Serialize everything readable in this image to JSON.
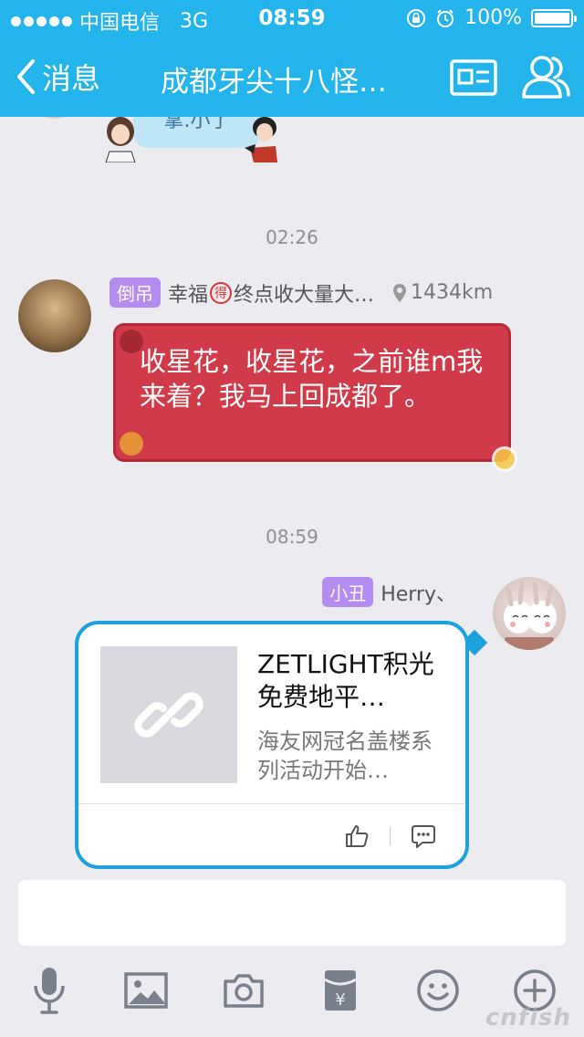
{
  "status_bar": {
    "carrier": "中国电信",
    "network": "3G",
    "time": "08:59",
    "battery": "100%",
    "battery_level": 1.0
  },
  "nav": {
    "back_label": "消息",
    "title": "成都牙尖十八怪…",
    "icons": {
      "back": "chevron-left-icon",
      "card": "group-card-icon",
      "profile": "group-members-icon"
    }
  },
  "chat": {
    "sticker_text": "掌.小了",
    "messages": [
      {
        "time": "02:26",
        "side": "left",
        "badge": "倒吊",
        "sender": "幸福",
        "medal": "得",
        "sender_suffix": "终点收大量大…",
        "location": "1434km",
        "text": "收星花，收星花，之前谁m我来着？我马上回成都了。",
        "bubble_color": "#d13a48"
      },
      {
        "time": "08:59",
        "side": "right",
        "badge": "小丑",
        "sender": "Herry、",
        "type": "link",
        "link_title": "ZETLIGHT积光免费地平…",
        "link_desc": "海友网冠名盖楼系列活动开始…",
        "bubble_color": "#1da1df"
      }
    ]
  },
  "input": {
    "placeholder": "",
    "value": ""
  },
  "toolbar": {
    "icons": [
      "microphone-icon",
      "image-icon",
      "camera-icon",
      "red-packet-icon",
      "emoji-icon",
      "plus-icon"
    ],
    "red_packet_glyph": "¥"
  },
  "watermark": "cnfish"
}
